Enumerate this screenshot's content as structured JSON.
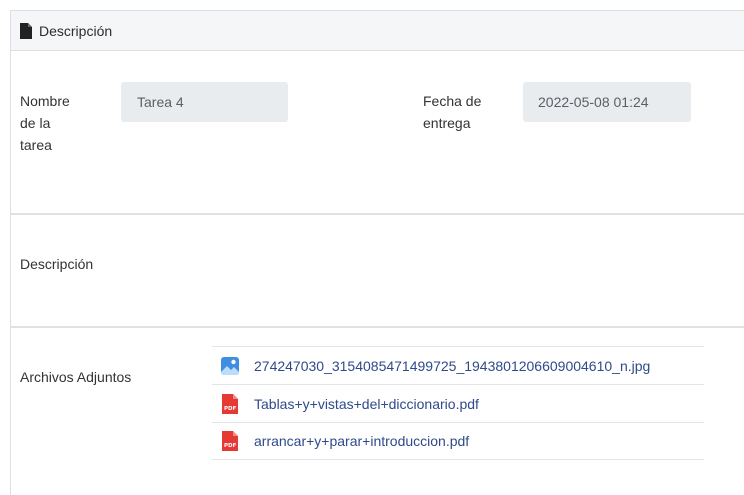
{
  "header": {
    "title": "Descripción",
    "icon": "file-icon"
  },
  "form": {
    "task_name_label": [
      "Nombre",
      "de la",
      "tarea"
    ],
    "task_name_value": "Tarea 4",
    "due_date_label": [
      "Fecha de",
      "entrega"
    ],
    "due_date_value": "2022-05-08 01:24"
  },
  "description": {
    "label": "Descripción"
  },
  "attachments": {
    "label": "Archivos Adjuntos",
    "items": [
      {
        "name": "274247030_3154085471499725_1943801206609004610_n.jpg",
        "type": "image",
        "icon": "image-icon"
      },
      {
        "name": "Tablas+y+vistas+del+diccionario.pdf",
        "type": "pdf",
        "icon": "pdf-icon"
      },
      {
        "name": "arrancar+y+parar+introduccion.pdf",
        "type": "pdf",
        "icon": "pdf-icon"
      }
    ]
  },
  "colors": {
    "link": "#2f4a8a",
    "pdf": "#e53935",
    "image": "#3f8ee0",
    "field_bg": "#e9ecef"
  }
}
